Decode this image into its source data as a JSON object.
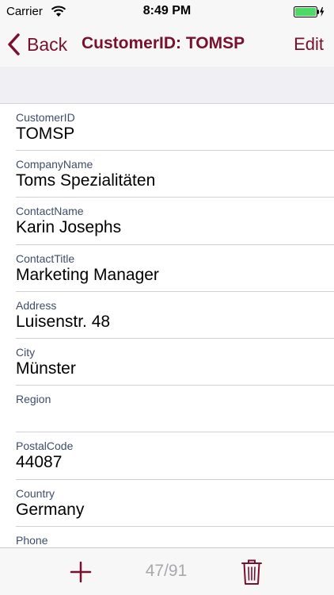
{
  "status_bar": {
    "carrier": "Carrier",
    "time": "8:49 PM",
    "wifi_icon": "wifi-icon",
    "battery_icon": "battery-full-icon",
    "battery_color": "#4cd964"
  },
  "nav": {
    "back_label": "Back",
    "title": "CustomerID: TOMSP",
    "edit_label": "Edit",
    "tint_color": "#7a1030"
  },
  "fields": [
    {
      "label": "CustomerID",
      "value": "TOMSP"
    },
    {
      "label": "CompanyName",
      "value": "Toms Spezialitäten"
    },
    {
      "label": "ContactName",
      "value": "Karin Josephs"
    },
    {
      "label": "ContactTitle",
      "value": "Marketing Manager"
    },
    {
      "label": "Address",
      "value": "Luisenstr. 48"
    },
    {
      "label": "City",
      "value": "Münster"
    },
    {
      "label": "Region",
      "value": ""
    },
    {
      "label": "PostalCode",
      "value": "44087"
    },
    {
      "label": "Country",
      "value": "Germany"
    },
    {
      "label": "Phone",
      "value": ""
    }
  ],
  "toolbar": {
    "add_icon": "plus-icon",
    "record_counter": "47/91",
    "delete_icon": "trash-icon"
  }
}
